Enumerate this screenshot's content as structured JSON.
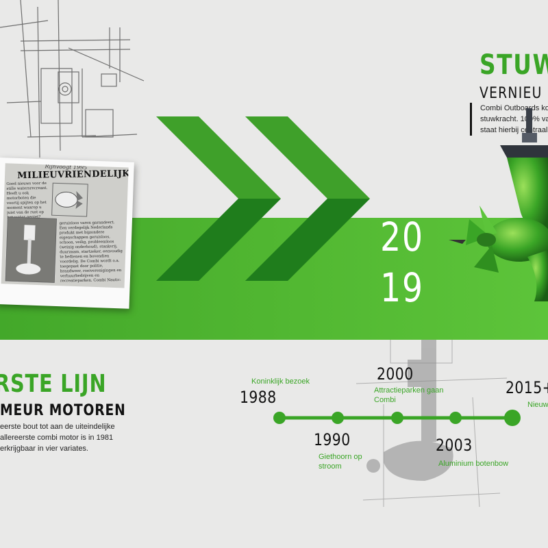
{
  "colors": {
    "accent": "#3aa526",
    "band": "#4db42f",
    "chevron_dark": "#1f7d1c",
    "text": "#111111",
    "background": "#e9e9e8"
  },
  "clipping": {
    "title": "MILIEUVRIENDELIJK",
    "handwriting": "Rijnvoogt  1995",
    "col1": "Goed nieuws voor de stille watersrecreant. Heeft u ook motorboten die voortij spijten op het moment waarop u juist van de rust op het water geniet? Motorlawaai op het water kan nu voorkomen worden. Combi Nautic heeft een electro-buitenboordmotor ontwikkeld, die",
    "col2": "geruisloos varen garandeert. Een verdegelijk Nederlands produkt met bijzondere eigenschappen geruisloos, schoon, veilig, probleemloos (weinig onderhoud), stankvrij, duurzaam, startzeker, eenvoudig te bedienen en bovendien voordelig. De Combi wordt o.a. toegepast door politie, brandweer, roeiverenigingen en verhuurbedrijven en recreatieparken. Combi Nautic: het schone geruisloze alternatief! Informatie: Combi Nautic BV Beukekenweg 129 aa, 8355 AL"
  },
  "top_right": {
    "title": "STUW",
    "subtitle": "VERNIEU",
    "body_lines": [
      "Combi Outboards ko",
      "stuwkracht. 100% va",
      "staat hierbij centraal"
    ]
  },
  "year": {
    "line1": "20",
    "line2": "19"
  },
  "bottom_left": {
    "title": "RSTE LIJN",
    "subtitle": "MEUR MOTOREN",
    "body_lines": [
      "eerste bout tot aan de uiteindelijke",
      "allereerste combi motor is in 1981",
      "erkrijgbaar in vier variates."
    ]
  },
  "timeline": {
    "events": [
      {
        "year": "1988",
        "label": "Koninklijk bezoek"
      },
      {
        "year": "1990",
        "label": "Giethoorn op stroom"
      },
      {
        "year": "2000",
        "label": "Attractieparken gaan Combi"
      },
      {
        "year": "2003",
        "label": "Aluminium botenbow"
      },
      {
        "year": "2015+",
        "label": "Nieuw"
      }
    ]
  }
}
